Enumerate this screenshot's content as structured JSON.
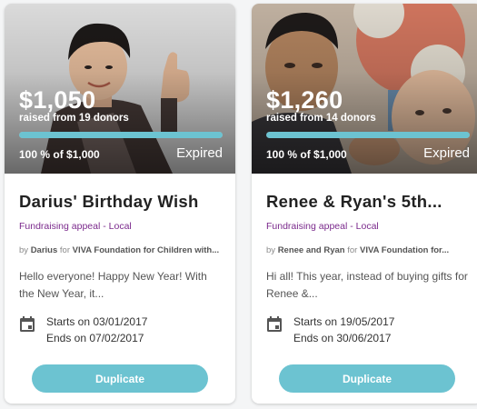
{
  "campaigns": [
    {
      "amount": "$1,050",
      "raised_text": "raised from 19 donors",
      "progress": 1.0,
      "progress_text": "100 % of $1,000",
      "status": "Expired",
      "title": "Darius' Birthday Wish",
      "category": "Fundraising appeal - Local",
      "by_prefix": "by",
      "owner": "Darius",
      "for_word": "for",
      "organization": "VIVA Foundation for Children",
      "org_suffix": "with...",
      "description": "Hello everyone! Happy New Year! With the New Year, it...",
      "start": "Starts on 03/01/2017",
      "end": "Ends on 07/02/2017",
      "button": "Duplicate"
    },
    {
      "amount": "$1,260",
      "raised_text": "raised from 14 donors",
      "progress": 1.0,
      "progress_text": "100 % of $1,000",
      "status": "Expired",
      "title": "Renee & Ryan's 5th...",
      "category": "Fundraising appeal - Local",
      "by_prefix": "by",
      "owner": "Renee and Ryan",
      "for_word": "for",
      "organization": "VIVA Foundation for...",
      "org_suffix": "",
      "description": "Hi all! This year, instead of buying gifts for Renee &...",
      "start": "Starts on 19/05/2017",
      "end": "Ends on 30/06/2017",
      "button": "Duplicate"
    }
  ],
  "colors": {
    "accent": "#6cc3d1",
    "category": "#7b2a8c"
  },
  "icons": [
    "calendar-icon"
  ]
}
